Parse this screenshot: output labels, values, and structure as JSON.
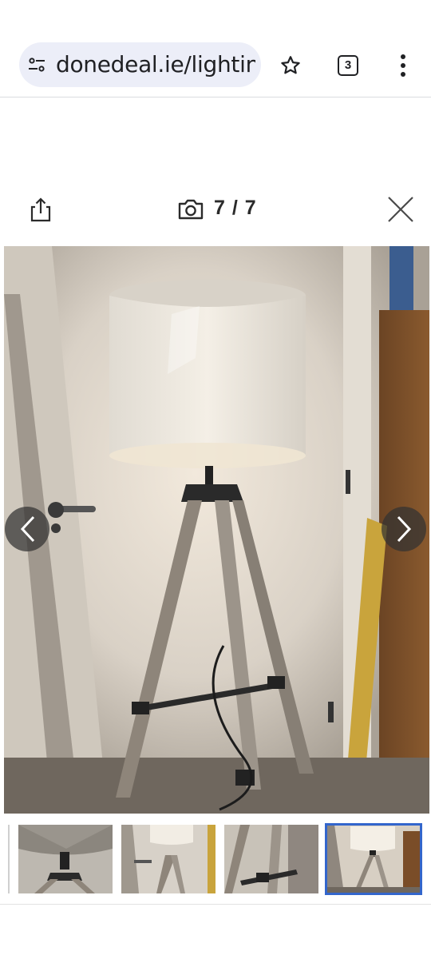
{
  "browser": {
    "url": "donedeal.ie/lightin",
    "tab_count": "3",
    "icons": [
      "tune-icon",
      "star-icon",
      "tabs-icon",
      "more-vert-icon"
    ]
  },
  "gallery": {
    "counter": "7 / 7",
    "icons": [
      "share-icon",
      "camera-icon",
      "close-icon",
      "chevron-left-icon",
      "chevron-right-icon"
    ],
    "current_image": 7,
    "total_images": 7,
    "thumbnails_visible": 4,
    "active_thumbnail": 4
  },
  "colors": {
    "active_thumbnail_border": "#3366cc",
    "address_bar_bg": "#eceef8"
  }
}
